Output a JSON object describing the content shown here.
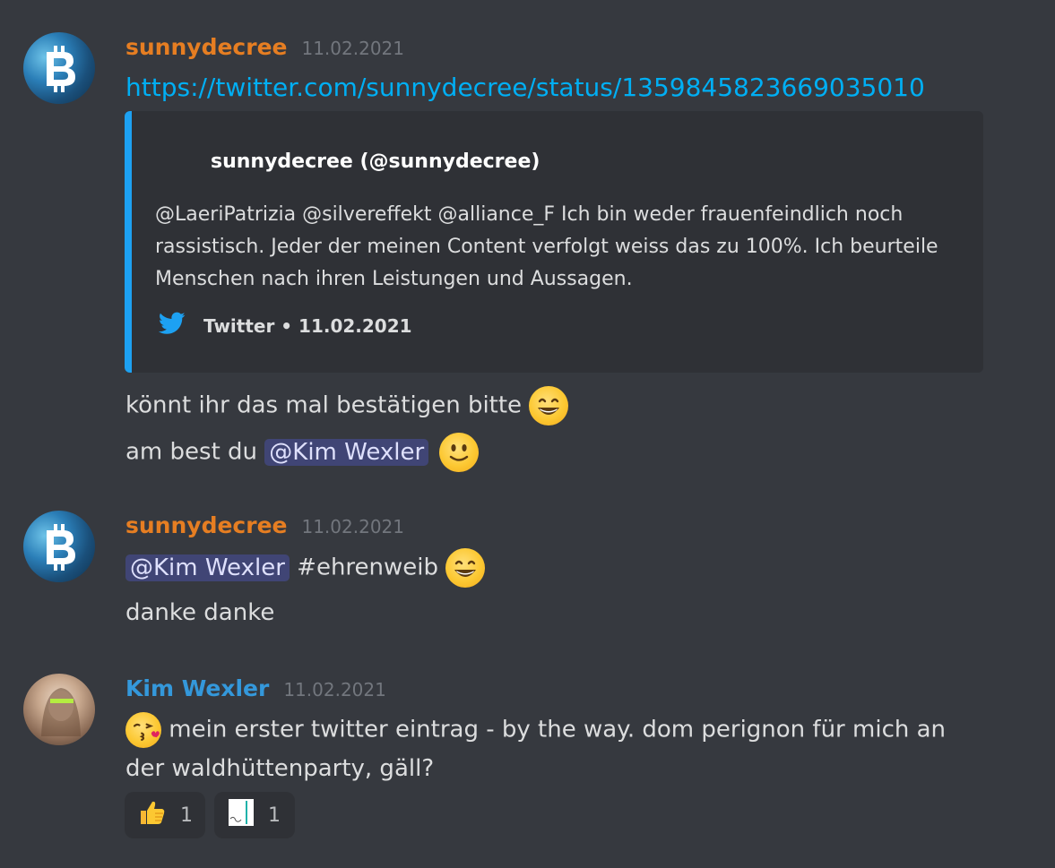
{
  "messages": [
    {
      "username": "sunnydecree",
      "timestamp": "11.02.2021",
      "link": "https://twitter.com/sunnydecree/status/1359845823669035010",
      "embed": {
        "author": "sunnydecree (@sunnydecree)",
        "description": "@LaeriPatrizia @silvereffekt @alliance_F Ich bin weder frauenfeindlich noch rassistisch. Jeder der meinen Content verfolgt weiss das zu 100%. Ich beurteile Menschen nach ihren Leistungen und Aussagen.",
        "footer": "Twitter • 11.02.2021"
      },
      "line1": "könnt ihr das mal bestätigen bitte",
      "line2_prefix": "am best du",
      "line2_mention": "@Kim Wexler"
    },
    {
      "username": "sunnydecree",
      "timestamp": "11.02.2021",
      "mention": "@Kim Wexler",
      "hashtag": "#ehrenweib",
      "line2": "danke danke"
    },
    {
      "username": "Kim Wexler",
      "timestamp": "11.02.2021",
      "line1": "mein erster twitter eintrag - by the way. dom perignon für mich an",
      "line2": "der waldhüttenparty, gäll?",
      "reactions": [
        {
          "icon": "thumbs-up-icon",
          "count": "1"
        },
        {
          "icon": "chart-sticker-icon",
          "count": "1"
        }
      ]
    }
  ],
  "colors": {
    "background": "#36393f",
    "embed_border": "#1da1f2",
    "username_orange": "#e67e22",
    "username_blue": "#3498db",
    "link": "#00aff4"
  }
}
